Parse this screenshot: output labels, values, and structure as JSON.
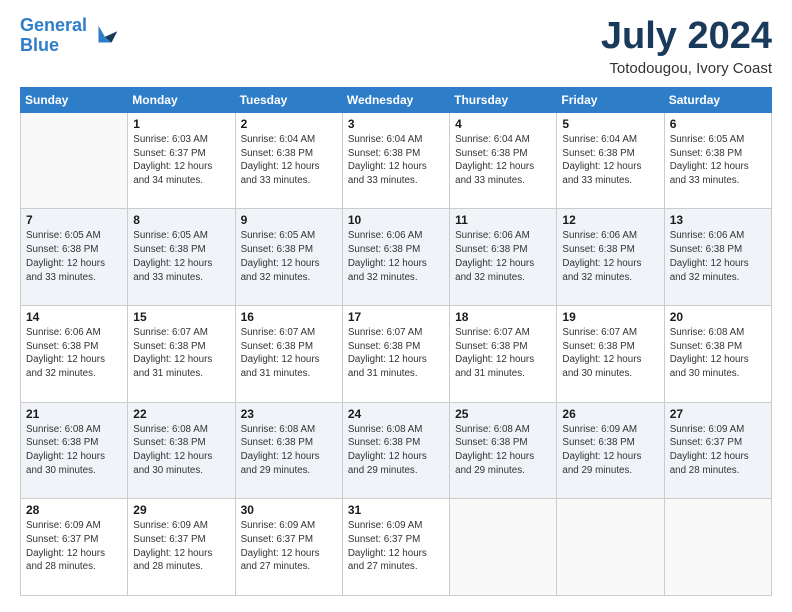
{
  "header": {
    "logo_line1": "General",
    "logo_line2": "Blue",
    "month_year": "July 2024",
    "location": "Totodougou, Ivory Coast"
  },
  "weekdays": [
    "Sunday",
    "Monday",
    "Tuesday",
    "Wednesday",
    "Thursday",
    "Friday",
    "Saturday"
  ],
  "weeks": [
    [
      {
        "day": "",
        "sunrise": "",
        "sunset": "",
        "daylight": ""
      },
      {
        "day": "1",
        "sunrise": "Sunrise: 6:03 AM",
        "sunset": "Sunset: 6:37 PM",
        "daylight": "Daylight: 12 hours and 34 minutes."
      },
      {
        "day": "2",
        "sunrise": "Sunrise: 6:04 AM",
        "sunset": "Sunset: 6:38 PM",
        "daylight": "Daylight: 12 hours and 33 minutes."
      },
      {
        "day": "3",
        "sunrise": "Sunrise: 6:04 AM",
        "sunset": "Sunset: 6:38 PM",
        "daylight": "Daylight: 12 hours and 33 minutes."
      },
      {
        "day": "4",
        "sunrise": "Sunrise: 6:04 AM",
        "sunset": "Sunset: 6:38 PM",
        "daylight": "Daylight: 12 hours and 33 minutes."
      },
      {
        "day": "5",
        "sunrise": "Sunrise: 6:04 AM",
        "sunset": "Sunset: 6:38 PM",
        "daylight": "Daylight: 12 hours and 33 minutes."
      },
      {
        "day": "6",
        "sunrise": "Sunrise: 6:05 AM",
        "sunset": "Sunset: 6:38 PM",
        "daylight": "Daylight: 12 hours and 33 minutes."
      }
    ],
    [
      {
        "day": "7",
        "sunrise": "Sunrise: 6:05 AM",
        "sunset": "Sunset: 6:38 PM",
        "daylight": "Daylight: 12 hours and 33 minutes."
      },
      {
        "day": "8",
        "sunrise": "Sunrise: 6:05 AM",
        "sunset": "Sunset: 6:38 PM",
        "daylight": "Daylight: 12 hours and 33 minutes."
      },
      {
        "day": "9",
        "sunrise": "Sunrise: 6:05 AM",
        "sunset": "Sunset: 6:38 PM",
        "daylight": "Daylight: 12 hours and 32 minutes."
      },
      {
        "day": "10",
        "sunrise": "Sunrise: 6:06 AM",
        "sunset": "Sunset: 6:38 PM",
        "daylight": "Daylight: 12 hours and 32 minutes."
      },
      {
        "day": "11",
        "sunrise": "Sunrise: 6:06 AM",
        "sunset": "Sunset: 6:38 PM",
        "daylight": "Daylight: 12 hours and 32 minutes."
      },
      {
        "day": "12",
        "sunrise": "Sunrise: 6:06 AM",
        "sunset": "Sunset: 6:38 PM",
        "daylight": "Daylight: 12 hours and 32 minutes."
      },
      {
        "day": "13",
        "sunrise": "Sunrise: 6:06 AM",
        "sunset": "Sunset: 6:38 PM",
        "daylight": "Daylight: 12 hours and 32 minutes."
      }
    ],
    [
      {
        "day": "14",
        "sunrise": "Sunrise: 6:06 AM",
        "sunset": "Sunset: 6:38 PM",
        "daylight": "Daylight: 12 hours and 32 minutes."
      },
      {
        "day": "15",
        "sunrise": "Sunrise: 6:07 AM",
        "sunset": "Sunset: 6:38 PM",
        "daylight": "Daylight: 12 hours and 31 minutes."
      },
      {
        "day": "16",
        "sunrise": "Sunrise: 6:07 AM",
        "sunset": "Sunset: 6:38 PM",
        "daylight": "Daylight: 12 hours and 31 minutes."
      },
      {
        "day": "17",
        "sunrise": "Sunrise: 6:07 AM",
        "sunset": "Sunset: 6:38 PM",
        "daylight": "Daylight: 12 hours and 31 minutes."
      },
      {
        "day": "18",
        "sunrise": "Sunrise: 6:07 AM",
        "sunset": "Sunset: 6:38 PM",
        "daylight": "Daylight: 12 hours and 31 minutes."
      },
      {
        "day": "19",
        "sunrise": "Sunrise: 6:07 AM",
        "sunset": "Sunset: 6:38 PM",
        "daylight": "Daylight: 12 hours and 30 minutes."
      },
      {
        "day": "20",
        "sunrise": "Sunrise: 6:08 AM",
        "sunset": "Sunset: 6:38 PM",
        "daylight": "Daylight: 12 hours and 30 minutes."
      }
    ],
    [
      {
        "day": "21",
        "sunrise": "Sunrise: 6:08 AM",
        "sunset": "Sunset: 6:38 PM",
        "daylight": "Daylight: 12 hours and 30 minutes."
      },
      {
        "day": "22",
        "sunrise": "Sunrise: 6:08 AM",
        "sunset": "Sunset: 6:38 PM",
        "daylight": "Daylight: 12 hours and 30 minutes."
      },
      {
        "day": "23",
        "sunrise": "Sunrise: 6:08 AM",
        "sunset": "Sunset: 6:38 PM",
        "daylight": "Daylight: 12 hours and 29 minutes."
      },
      {
        "day": "24",
        "sunrise": "Sunrise: 6:08 AM",
        "sunset": "Sunset: 6:38 PM",
        "daylight": "Daylight: 12 hours and 29 minutes."
      },
      {
        "day": "25",
        "sunrise": "Sunrise: 6:08 AM",
        "sunset": "Sunset: 6:38 PM",
        "daylight": "Daylight: 12 hours and 29 minutes."
      },
      {
        "day": "26",
        "sunrise": "Sunrise: 6:09 AM",
        "sunset": "Sunset: 6:38 PM",
        "daylight": "Daylight: 12 hours and 29 minutes."
      },
      {
        "day": "27",
        "sunrise": "Sunrise: 6:09 AM",
        "sunset": "Sunset: 6:37 PM",
        "daylight": "Daylight: 12 hours and 28 minutes."
      }
    ],
    [
      {
        "day": "28",
        "sunrise": "Sunrise: 6:09 AM",
        "sunset": "Sunset: 6:37 PM",
        "daylight": "Daylight: 12 hours and 28 minutes."
      },
      {
        "day": "29",
        "sunrise": "Sunrise: 6:09 AM",
        "sunset": "Sunset: 6:37 PM",
        "daylight": "Daylight: 12 hours and 28 minutes."
      },
      {
        "day": "30",
        "sunrise": "Sunrise: 6:09 AM",
        "sunset": "Sunset: 6:37 PM",
        "daylight": "Daylight: 12 hours and 27 minutes."
      },
      {
        "day": "31",
        "sunrise": "Sunrise: 6:09 AM",
        "sunset": "Sunset: 6:37 PM",
        "daylight": "Daylight: 12 hours and 27 minutes."
      },
      {
        "day": "",
        "sunrise": "",
        "sunset": "",
        "daylight": ""
      },
      {
        "day": "",
        "sunrise": "",
        "sunset": "",
        "daylight": ""
      },
      {
        "day": "",
        "sunrise": "",
        "sunset": "",
        "daylight": ""
      }
    ]
  ]
}
